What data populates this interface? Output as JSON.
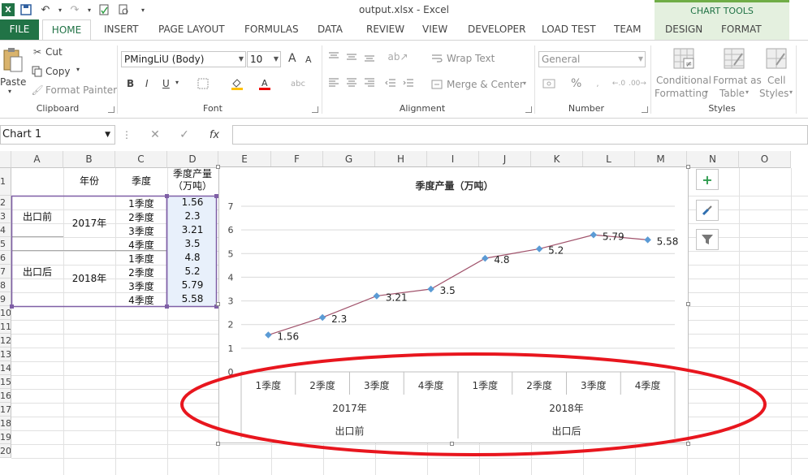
{
  "window": {
    "title": "output.xlsx - Excel",
    "logo_text": "X",
    "chart_tools_label": "CHART TOOLS"
  },
  "tabs": [
    {
      "label": "FILE"
    },
    {
      "label": "HOME"
    },
    {
      "label": "INSERT"
    },
    {
      "label": "PAGE LAYOUT"
    },
    {
      "label": "FORMULAS"
    },
    {
      "label": "DATA"
    },
    {
      "label": "REVIEW"
    },
    {
      "label": "VIEW"
    },
    {
      "label": "DEVELOPER"
    },
    {
      "label": "LOAD TEST"
    },
    {
      "label": "TEAM"
    },
    {
      "label": "DESIGN"
    },
    {
      "label": "FORMAT"
    }
  ],
  "ribbon": {
    "clipboard": {
      "paste": "Paste",
      "cut": "Cut",
      "copy": "Copy",
      "format_painter": "Format Painter",
      "label": "Clipboard"
    },
    "font": {
      "name": "PMingLiU (Body)",
      "size": "10",
      "bold": "B",
      "italic": "I",
      "underline": "U",
      "grow": "A",
      "shrink": "A",
      "label": "Font"
    },
    "alignment": {
      "wrap": "Wrap Text",
      "merge": "Merge & Center",
      "label": "Alignment"
    },
    "number": {
      "format": "General",
      "percent": "%",
      "label": "Number"
    },
    "styles": {
      "conditional_1": "Conditional",
      "conditional_2": "Formatting",
      "format_table_1": "Format as",
      "format_table_2": "Table",
      "cell_styles_1": "Cell",
      "cell_styles_2": "Styles",
      "label": "Styles"
    }
  },
  "formula_bar": {
    "name_box": "Chart 1",
    "fx": "fx",
    "cancel": "✕",
    "enter": "✓"
  },
  "sheet": {
    "columns": [
      "A",
      "B",
      "C",
      "D",
      "E",
      "F",
      "G",
      "H",
      "I",
      "J",
      "K",
      "L",
      "M",
      "N",
      "O"
    ],
    "rows": [
      "1",
      "2",
      "3",
      "4",
      "5",
      "6",
      "7",
      "8",
      "9",
      "10",
      "11",
      "12",
      "13",
      "14",
      "15",
      "16",
      "17",
      "18",
      "19",
      "20"
    ],
    "header": {
      "year": "年份",
      "quarter": "季度",
      "output_1": "季度产量",
      "output_2": "（万吨）"
    },
    "group_a": [
      "出口前",
      "出口后"
    ],
    "group_b": [
      "2017年",
      "2018年"
    ],
    "quarters": [
      "1季度",
      "2季度",
      "3季度",
      "4季度",
      "1季度",
      "2季度",
      "3季度",
      "4季度"
    ],
    "values": [
      "1.56",
      "2.3",
      "3.21",
      "3.5",
      "4.8",
      "5.2",
      "5.79",
      "5.58"
    ]
  },
  "chart_data": {
    "type": "line",
    "title": "季度产量（万吨）",
    "categories_level1": [
      "1季度",
      "2季度",
      "3季度",
      "4季度",
      "1季度",
      "2季度",
      "3季度",
      "4季度"
    ],
    "categories_level2": [
      "2017年",
      "2018年"
    ],
    "categories_level3": [
      "出口前",
      "出口后"
    ],
    "series": [
      {
        "values": [
          1.56,
          2.3,
          3.21,
          3.5,
          4.8,
          5.2,
          5.79,
          5.58
        ],
        "color": "#a0526b",
        "marker_color": "#5b9bd5"
      }
    ],
    "yticks": [
      "0",
      "1",
      "2",
      "3",
      "4",
      "5",
      "6",
      "7"
    ],
    "ylim": [
      0,
      7
    ],
    "grid": true,
    "data_labels": [
      "1.56",
      "2.3",
      "3.21",
      "3.5",
      "4.8",
      "5.2",
      "5.79",
      "5.58"
    ]
  },
  "annotation": {
    "ellipse_color": "#e8161e"
  }
}
